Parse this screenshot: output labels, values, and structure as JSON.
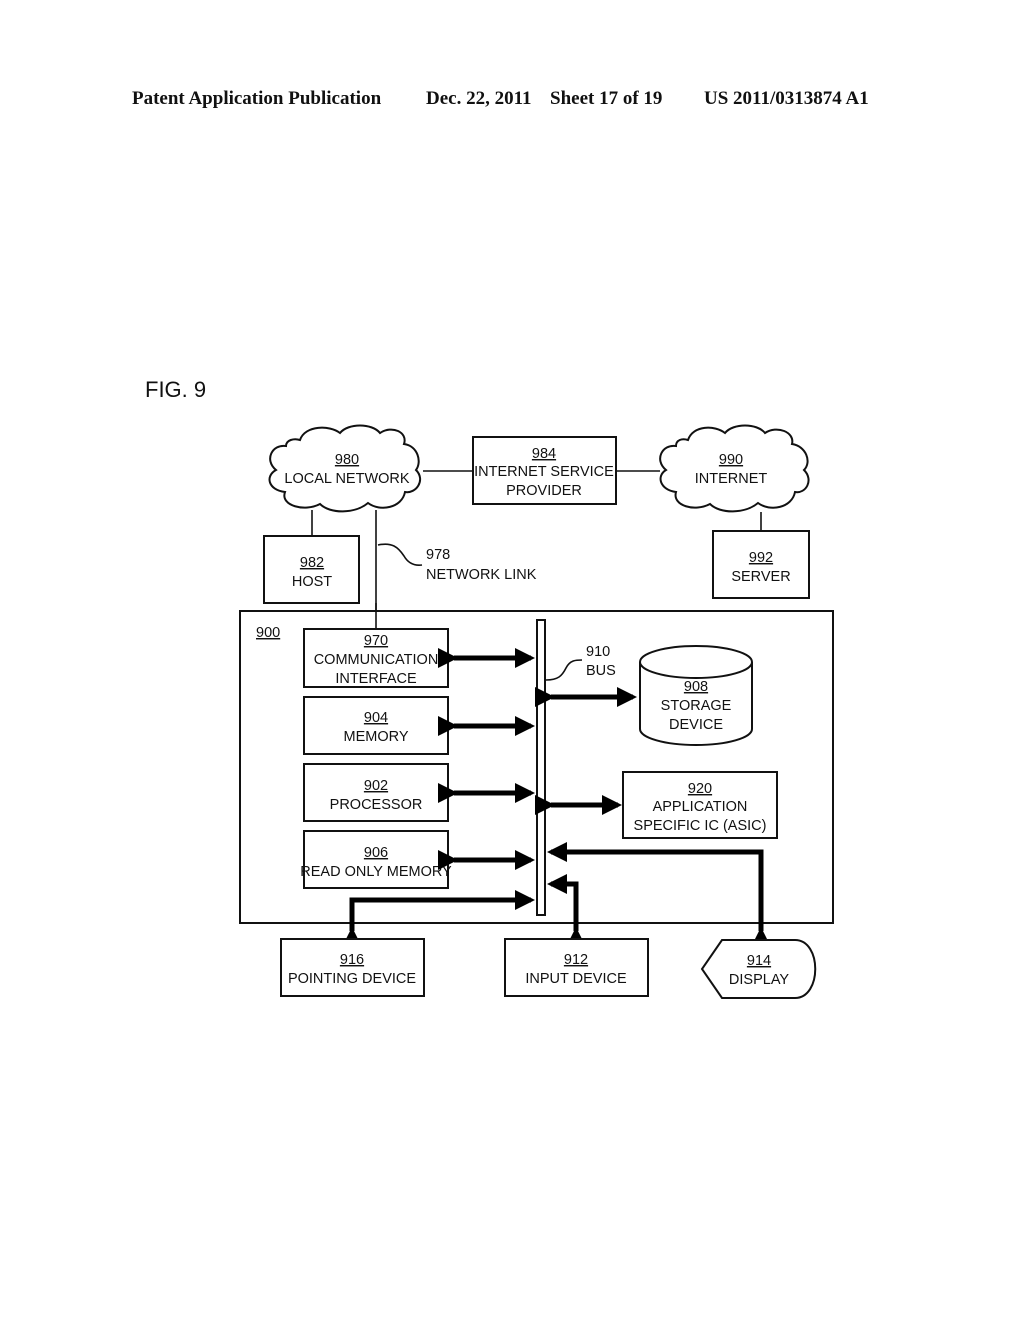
{
  "header": {
    "publication": "Patent Application Publication",
    "date": "Dec. 22, 2011",
    "sheet": "Sheet 17 of 19",
    "number": "US 2011/0313874 A1"
  },
  "figure": {
    "label": "FIG. 9"
  },
  "nodes": {
    "local_network": {
      "ref": "980",
      "lines": [
        "LOCAL NETWORK"
      ],
      "shape": "cloud"
    },
    "isp": {
      "ref": "984",
      "lines": [
        "INTERNET SERVICE",
        "PROVIDER"
      ],
      "shape": "rectangle"
    },
    "internet": {
      "ref": "990",
      "lines": [
        "INTERNET"
      ],
      "shape": "cloud"
    },
    "host": {
      "ref": "982",
      "lines": [
        "HOST"
      ],
      "shape": "rectangle"
    },
    "server": {
      "ref": "992",
      "lines": [
        "SERVER"
      ],
      "shape": "rectangle"
    },
    "network_link": {
      "ref": "978",
      "lines": [
        "NETWORK LINK"
      ],
      "shape": "callout"
    },
    "computer_system": {
      "ref": "900",
      "shape": "container"
    },
    "comm_interface": {
      "ref": "970",
      "lines": [
        "COMMUNICATION",
        "INTERFACE"
      ],
      "shape": "rectangle"
    },
    "memory": {
      "ref": "904",
      "lines": [
        "MEMORY"
      ],
      "shape": "rectangle"
    },
    "processor": {
      "ref": "902",
      "lines": [
        "PROCESSOR"
      ],
      "shape": "rectangle"
    },
    "rom": {
      "ref": "906",
      "lines": [
        "READ ONLY MEMORY"
      ],
      "shape": "rectangle"
    },
    "bus": {
      "ref": "910",
      "lines": [
        "BUS"
      ],
      "shape": "bar"
    },
    "storage": {
      "ref": "908",
      "lines": [
        "STORAGE",
        "DEVICE"
      ],
      "shape": "cylinder"
    },
    "asic": {
      "ref": "920",
      "lines": [
        "APPLICATION",
        "SPECIFIC IC (ASIC)"
      ],
      "shape": "rectangle"
    },
    "pointing_device": {
      "ref": "916",
      "lines": [
        "POINTING DEVICE"
      ],
      "shape": "rectangle"
    },
    "input_device": {
      "ref": "912",
      "lines": [
        "INPUT DEVICE"
      ],
      "shape": "rectangle"
    },
    "display": {
      "ref": "914",
      "lines": [
        "DISPLAY"
      ],
      "shape": "display"
    }
  },
  "edges": [
    {
      "from": "local_network",
      "to": "isp",
      "type": "line"
    },
    {
      "from": "isp",
      "to": "internet",
      "type": "line"
    },
    {
      "from": "local_network",
      "to": "host",
      "type": "line"
    },
    {
      "from": "internet",
      "to": "server",
      "type": "line"
    },
    {
      "from": "local_network",
      "to": "comm_interface",
      "type": "line",
      "label": "network_link"
    },
    {
      "from": "comm_interface",
      "to": "bus",
      "type": "bidirectional"
    },
    {
      "from": "memory",
      "to": "bus",
      "type": "bidirectional"
    },
    {
      "from": "processor",
      "to": "bus",
      "type": "bidirectional"
    },
    {
      "from": "rom",
      "to": "bus",
      "type": "bidirectional"
    },
    {
      "from": "bus",
      "to": "storage",
      "type": "bidirectional"
    },
    {
      "from": "bus",
      "to": "asic",
      "type": "bidirectional"
    },
    {
      "from": "bus",
      "to": "display",
      "type": "directed"
    },
    {
      "from": "input_device",
      "to": "bus",
      "type": "directed"
    },
    {
      "from": "pointing_device",
      "to": "bus",
      "type": "directed"
    }
  ]
}
